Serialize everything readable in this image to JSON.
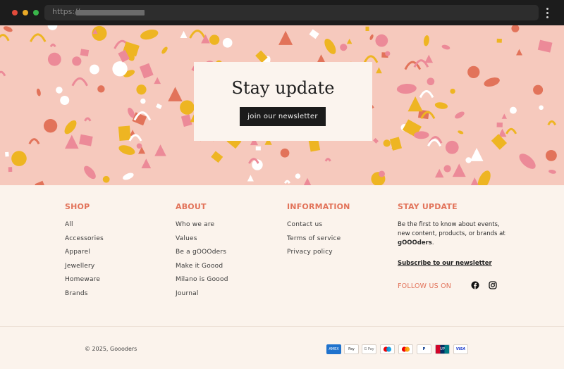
{
  "browser": {
    "url_protocol": "https://"
  },
  "hero": {
    "title": "Stay update",
    "button_label": "join our newsletter",
    "colors": {
      "background": "#f6c9bd",
      "pink": "#ec8a98",
      "yellow": "#eeb522",
      "white": "#ffffff",
      "red": "#e2735a"
    }
  },
  "footer": {
    "columns": [
      {
        "heading": "SHOP",
        "items": [
          "All",
          "Accessories",
          "Apparel",
          "Jewellery",
          "Homeware",
          "Brands"
        ]
      },
      {
        "heading": "ABOUT",
        "items": [
          "Who we are",
          "Values",
          "Be a gOOOders",
          "Make it Goood",
          "Milano is Goood",
          "Journal"
        ]
      },
      {
        "heading": "INFORMATION",
        "items": [
          "Contact us",
          "Terms of service",
          "Privacy policy"
        ]
      }
    ],
    "stay": {
      "heading": "STAY UPDATE",
      "text_before": "Be the first to know about events, new content, products, or brands at ",
      "brand": "gOOOders",
      "text_after": ".",
      "subscribe_label": "Subscribe to our newsletter",
      "follow_label": "FOLLOW US ON",
      "social": [
        "facebook-icon",
        "instagram-icon"
      ]
    },
    "copyright": "© 2025, Goooders",
    "payments": [
      {
        "name": "amex-icon",
        "label": "AMEX"
      },
      {
        "name": "apple-pay-icon",
        "label": "Pay"
      },
      {
        "name": "google-pay-icon",
        "label": "G Pay"
      },
      {
        "name": "maestro-icon",
        "label": ""
      },
      {
        "name": "mastercard-icon",
        "label": ""
      },
      {
        "name": "paypal-icon",
        "label": "P"
      },
      {
        "name": "union-pay-icon",
        "label": "UP"
      },
      {
        "name": "visa-icon",
        "label": "VISA"
      }
    ],
    "accent_color": "#e2735a"
  }
}
